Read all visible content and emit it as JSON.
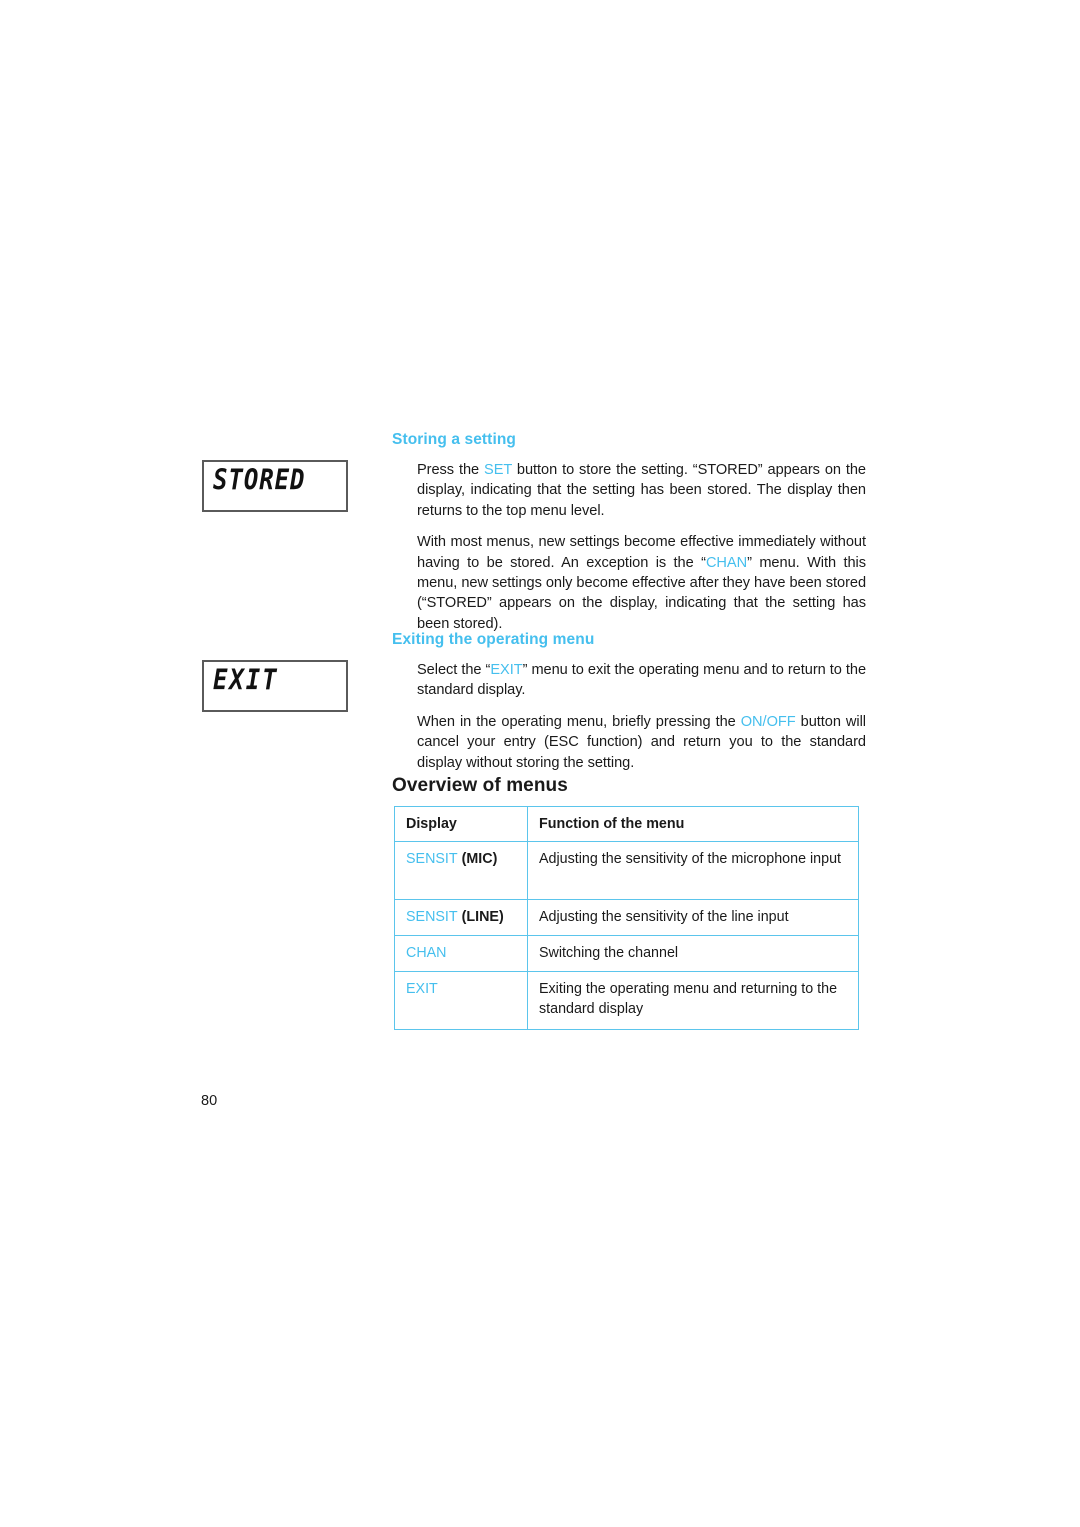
{
  "figures": [
    {
      "name": "stored-display",
      "text": "STORED"
    },
    {
      "name": "exit-display",
      "text": "EXIT"
    }
  ],
  "sections": {
    "storing": {
      "heading": "Storing a setting",
      "paragraph1": {
        "part1": "Press the ",
        "highlight1": "SET",
        "part2": " button to store the setting. “STORED” appears on the display, indicating that the setting has been stored. The display then returns to the top menu level."
      },
      "paragraph2": {
        "part1": "With most menus, new settings become effective immediately without having to be stored. An exception is the “",
        "highlight1": "CHAN",
        "part2": "” menu. With this menu, new settings only become effective after they have been stored (“STORED” appears on the display, indicating that the setting has been stored)."
      }
    },
    "exiting": {
      "heading": "Exiting the operating menu",
      "paragraph1": {
        "part1": "Select the “",
        "highlight1": "EXIT",
        "part2": "” menu to exit the operating menu and to return to the standard display."
      },
      "paragraph2": {
        "part1": "When in the operating menu, briefly pressing the ",
        "highlight1": "ON",
        "separator": "/",
        "highlight2": "OFF",
        "part2": " button will cancel your entry (ESC function) and return you to the standard display without storing the setting."
      }
    }
  },
  "overview": {
    "title": "Overview of menus",
    "table": {
      "headers": [
        "Display",
        "Function of the menu"
      ],
      "rows": [
        {
          "display_code": "SENSIT",
          "display_suffix": " (MIC)",
          "function": "Adjusting the sensitivity of the microphone input"
        },
        {
          "display_code": "SENSIT",
          "display_suffix": " (LINE)",
          "function": "Adjusting the sensitivity of the line input"
        },
        {
          "display_code": "CHAN",
          "display_suffix": "",
          "function": "Switching the channel"
        },
        {
          "display_code": "EXIT",
          "display_suffix": "",
          "function": "Exiting the operating menu and returning to the standard display"
        }
      ]
    }
  },
  "footer": {
    "page_number": "80"
  },
  "colors": {
    "accent": "#45bfee",
    "table_border": "#5bc5ec",
    "text": "#1a1a1a",
    "lcd_border": "#5a5a5a"
  }
}
